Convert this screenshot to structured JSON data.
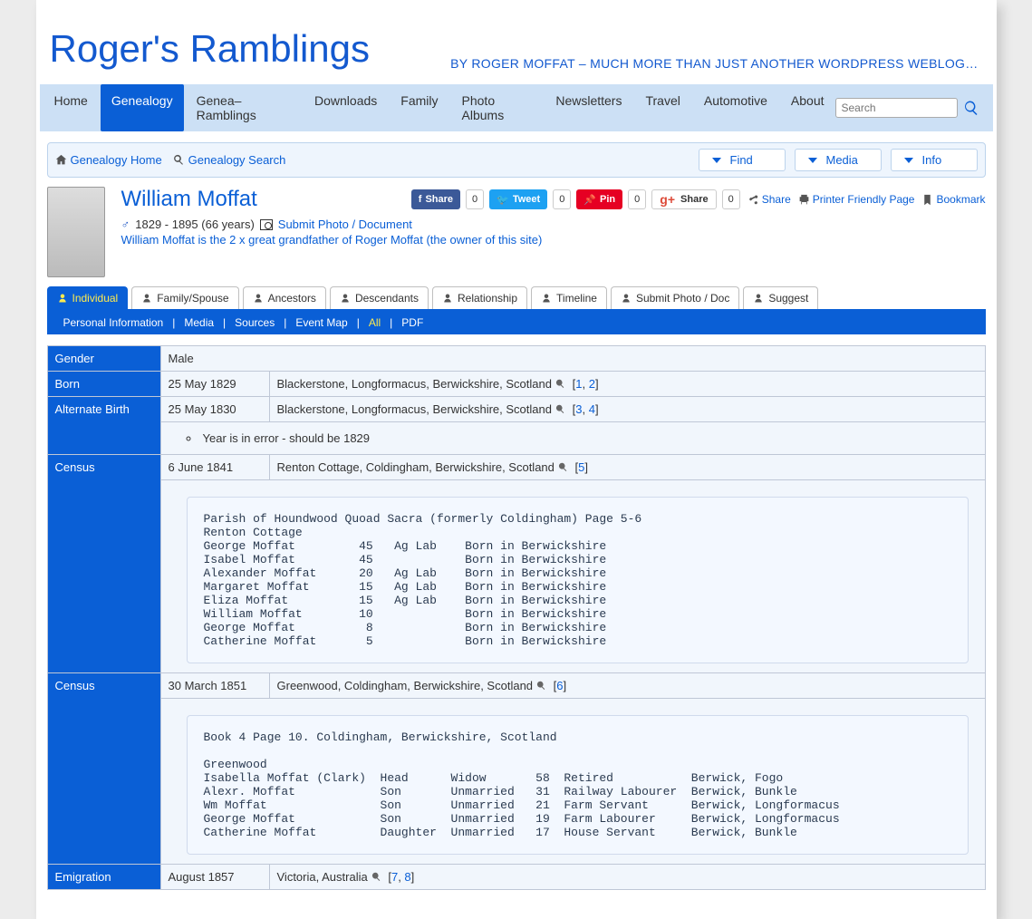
{
  "site": {
    "title": "Roger's Ramblings",
    "tagline": "BY ROGER MOFFAT – MUCH MORE THAN JUST ANOTHER WORDPRESS WEBLOG…"
  },
  "nav": [
    {
      "label": "Home"
    },
    {
      "label": "Genealogy",
      "on": true
    },
    {
      "label": "Genea–Ramblings"
    },
    {
      "label": "Downloads"
    },
    {
      "label": "Family"
    },
    {
      "label": "Photo Albums"
    },
    {
      "label": "Newsletters"
    },
    {
      "label": "Travel"
    },
    {
      "label": "Automotive"
    },
    {
      "label": "About"
    }
  ],
  "search": {
    "placeholder": "Search"
  },
  "crumbs": {
    "home": "Genealogy Home",
    "search": "Genealogy Search",
    "drop1": "Find",
    "drop2": "Media",
    "drop3": "Info"
  },
  "social": {
    "fb": "Share",
    "fb_count": "0",
    "tw": "Tweet",
    "tw_count": "0",
    "pin": "Pin",
    "pin_count": "0",
    "gp": "Share",
    "gp_count": "0",
    "share": "Share",
    "print": "Printer Friendly Page",
    "bookmark": "Bookmark"
  },
  "person": {
    "name": "William Moffat",
    "dates": "1829 - 1895  (66 years)",
    "submit": "Submit Photo / Document",
    "relnote": "William Moffat is the 2 x great grandfather of Roger Moffat (the owner of this site)"
  },
  "tabs": [
    "Individual",
    "Family/Spouse",
    "Ancestors",
    "Descendants",
    "Relationship",
    "Timeline",
    "Submit Photo / Doc",
    "Suggest"
  ],
  "subtabs": {
    "a": "Personal Information",
    "b": "Media",
    "c": "Sources",
    "d": "Event Map",
    "e": "All",
    "f": "PDF"
  },
  "refs": {
    "open": "[",
    "close": "]",
    "comma": ", "
  },
  "facts": {
    "gender": {
      "label": "Gender",
      "value": "Male"
    },
    "born": {
      "label": "Born",
      "date": "25 May 1829",
      "place": "Blackerstone, Longformacus, Berwickshire, Scotland",
      "r1": "1",
      "r2": "2"
    },
    "altbirth": {
      "label": "Alternate Birth",
      "date": "25 May 1830",
      "place": "Blackerstone, Longformacus, Berwickshire, Scotland",
      "r1": "3",
      "r2": "4",
      "note": "Year is in error - should be 1829"
    },
    "census1": {
      "label": "Census",
      "date": "6 June 1841",
      "place": "Renton Cottage, Coldingham, Berwickshire, Scotland",
      "r1": "5",
      "text": "Parish of Houndwood Quoad Sacra (formerly Coldingham) Page 5-6\nRenton Cottage\nGeorge Moffat         45   Ag Lab    Born in Berwickshire\nIsabel Moffat         45             Born in Berwickshire\nAlexander Moffat      20   Ag Lab    Born in Berwickshire\nMargaret Moffat       15   Ag Lab    Born in Berwickshire\nEliza Moffat          15   Ag Lab    Born in Berwickshire\nWilliam Moffat        10             Born in Berwickshire\nGeorge Moffat          8             Born in Berwickshire\nCatherine Moffat       5             Born in Berwickshire"
    },
    "census2": {
      "label": "Census",
      "date": "30 March 1851",
      "place": "Greenwood, Coldingham, Berwickshire, Scotland",
      "r1": "6",
      "text": "Book 4 Page 10. Coldingham, Berwickshire, Scotland\n\nGreenwood\nIsabella Moffat (Clark)  Head      Widow       58  Retired           Berwick, Fogo\nAlexr. Moffat            Son       Unmarried   31  Railway Labourer  Berwick, Bunkle\nWm Moffat                Son       Unmarried   21  Farm Servant      Berwick, Longformacus\nGeorge Moffat            Son       Unmarried   19  Farm Labourer     Berwick, Longformacus\nCatherine Moffat         Daughter  Unmarried   17  House Servant     Berwick, Bunkle"
    },
    "emigration": {
      "label": "Emigration",
      "date": "August 1857",
      "place": "Victoria, Australia",
      "r1": "7",
      "r2": "8"
    }
  }
}
